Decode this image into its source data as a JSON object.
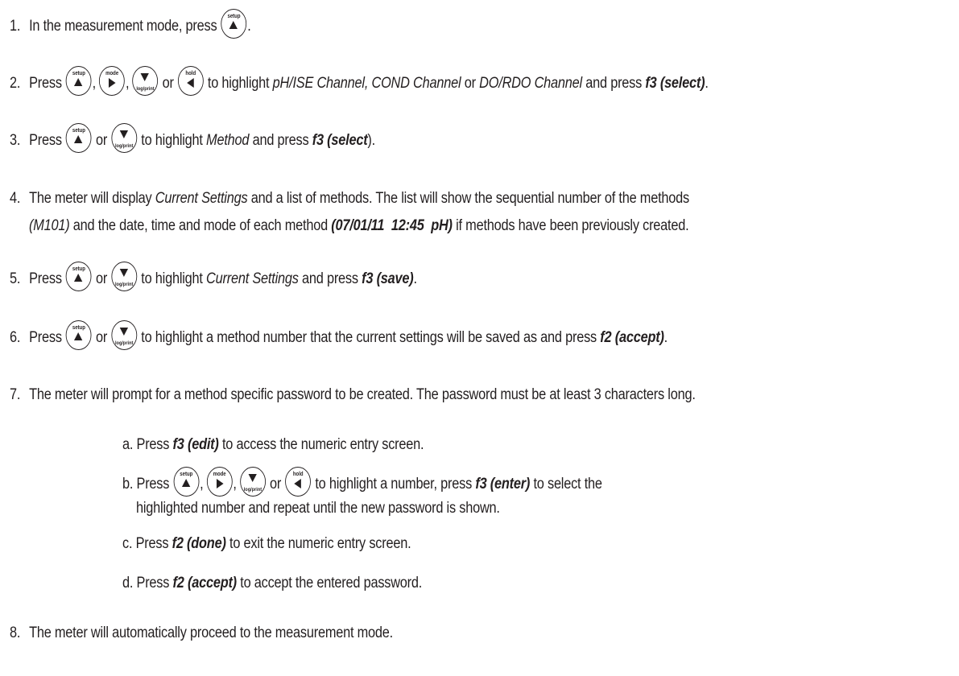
{
  "keys": {
    "setup": {
      "label": "setup",
      "icon": "up-arrow-icon"
    },
    "mode": {
      "label": "mode",
      "icon": "right-arrow-icon"
    },
    "logprint": {
      "label": "log/print",
      "icon": "down-arrow-icon"
    },
    "hold": {
      "label": "hold",
      "icon": "left-arrow-icon"
    }
  },
  "steps": {
    "s1": {
      "num": "1.",
      "a": "In the measurement mode, press ",
      "b": "."
    },
    "s2": {
      "num": "2.",
      "press": "Press ",
      "comma1": ",",
      "comma2": ",",
      "or": " or ",
      "a": " to highlight ",
      "i1": "pH/ISE Channel, COND Channel",
      "mid": " or ",
      "i2": "DO/RDO Channel",
      "c": " and press ",
      "f": "f3 (select)",
      "end": "."
    },
    "s3": {
      "num": "3.",
      "press": "Press ",
      "or": " or ",
      "a": " to highlight ",
      "i": "Method",
      "c": " and press ",
      "f": "f3 (select",
      "end": ")."
    },
    "s4": {
      "num": "4.",
      "a": "The meter will display ",
      "i": "Current Settings",
      "b": " and a list of methods. The list will show the sequential number of the methods",
      "i2": "(M101)",
      "c": " and the date, time and mode of each method ",
      "bi": "(07/01/11  12:45  pH)",
      "d": " if methods have been previously created."
    },
    "s5": {
      "num": "5.",
      "press": "Press ",
      "or": " or ",
      "a": " to highlight ",
      "i": "Current Settings",
      "c": " and press ",
      "f": "f3 (save)",
      "end": "."
    },
    "s6": {
      "num": "6.",
      "press": "Press ",
      "or": " or ",
      "a": " to highlight a method number that the current settings will be saved as and press ",
      "f": "f2 (accept)",
      "end": "."
    },
    "s7": {
      "num": "7.",
      "a": "The meter will prompt for a method specific password to be created. The password must be at least 3 characters long."
    },
    "s7a": {
      "a": "a. Press ",
      "f": "f3 (edit)",
      "b": " to access the numeric entry screen."
    },
    "s7b": {
      "a": "b. Press ",
      "comma1": ",",
      "comma2": ",",
      "or": " or ",
      "b": " to highlight a number, press ",
      "f": "f3 (enter)",
      "c": " to select the",
      "d": "highlighted number and repeat until the new password is shown."
    },
    "s7c": {
      "a": "c. Press ",
      "f": "f2 (done)",
      "b": " to exit the numeric entry screen."
    },
    "s7d": {
      "a": "d. Press ",
      "f": "f2 (accept)",
      "b": " to accept the entered password."
    },
    "s8": {
      "num": "8.",
      "a": "The meter will automatically proceed to the measurement mode."
    }
  }
}
